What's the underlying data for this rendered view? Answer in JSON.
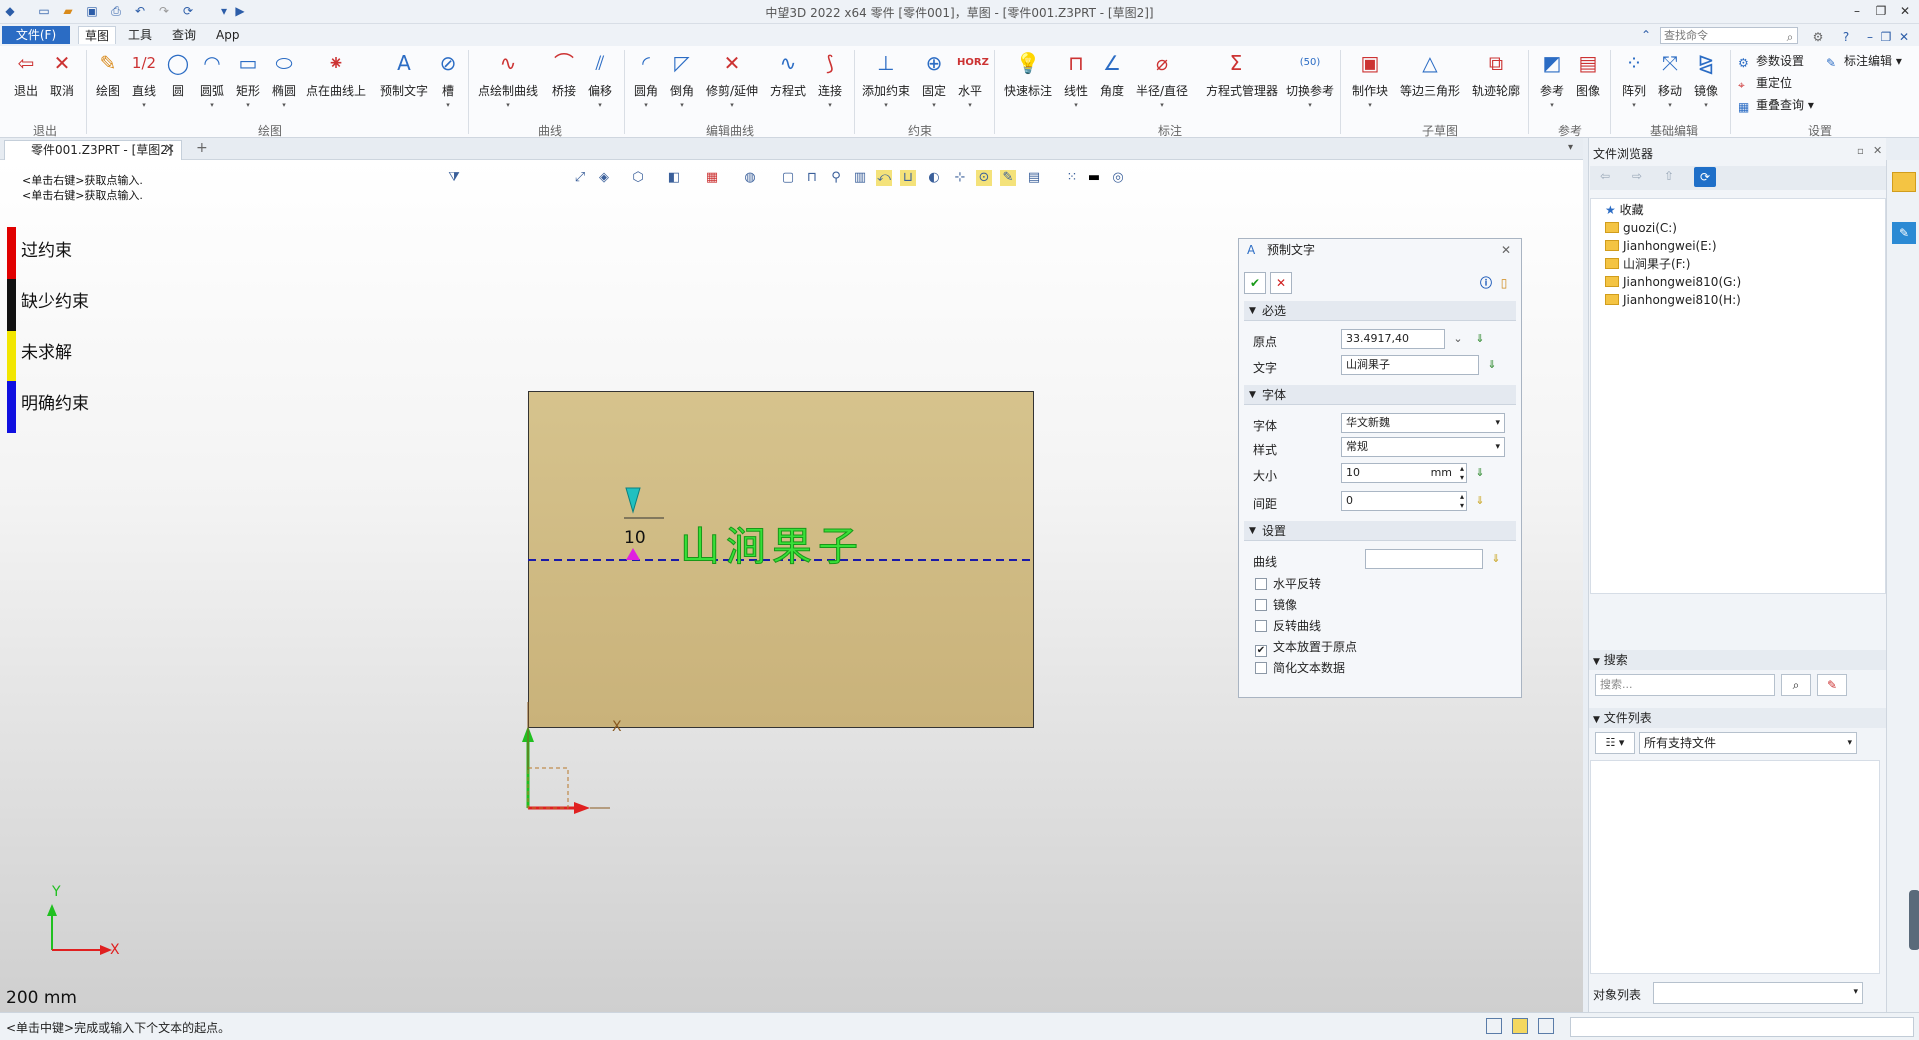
{
  "title_bar": {
    "title": "中望3D 2022 x64        零件 [零件001]，草图 - [零件001.Z3PRT - [草图2]]"
  },
  "menu": {
    "file": "文件(F)",
    "items": [
      "草图",
      "工具",
      "查询",
      "App"
    ],
    "search_placeholder": "查找命令"
  },
  "ribbon": {
    "buttons": {
      "exit": "退出",
      "cancel": "取消",
      "draw": "绘图",
      "line": "直线",
      "circle": "圆",
      "arc": "圆弧",
      "rect": "矩形",
      "ellipse": "椭圆",
      "point_on_curve": "点在曲线上",
      "preset_text": "预制文字",
      "slot": "槽",
      "spline": "点绘制曲线",
      "bridge": "桥接",
      "offset": "偏移",
      "fillet": "圆角",
      "chamfer": "倒角",
      "trim": "修剪/延伸",
      "equation": "方程式",
      "connect": "连接",
      "add_constraint": "添加约束",
      "fix": "固定",
      "horizontal": "水平",
      "quick_dim": "快速标注",
      "linear": "线性",
      "angle": "角度",
      "radius": "半径/直径",
      "eq_manager": "方程式管理器",
      "toggle_ref": "切换参考",
      "make_block": "制作块",
      "equilateral": "等边三角形",
      "trace_outline": "轨迹轮廓",
      "reference": "参考",
      "image": "图像",
      "array": "阵列",
      "move": "移动",
      "mirror": "镜像"
    },
    "icon_texts": {
      "line": "1/2",
      "horizontal": "HORZ",
      "toggle_ref": "(50)"
    },
    "small_cmds": {
      "param_settings": "参数设置",
      "relocate": "重定位",
      "overlap_query": "重叠查询",
      "dim_edit": "标注编辑"
    },
    "groups": {
      "exit": "退出",
      "draw": "绘图",
      "curve": "曲线",
      "edit": "编辑曲线",
      "constraint": "约束",
      "dimension": "标注",
      "sub": "子草图",
      "ref": "参考",
      "basic_edit": "基础编辑",
      "settings": "设置"
    }
  },
  "doc_tab": "零件001.Z3PRT - [草图2]",
  "viewport": {
    "prompts": [
      "<单击右键>获取点输入.",
      "<单击右键>获取点输入."
    ],
    "legend": [
      {
        "label": "过约束",
        "color": "#e00000"
      },
      {
        "label": "缺少约束",
        "color": "#111111"
      },
      {
        "label": "未求解",
        "color": "#f2e600"
      },
      {
        "label": "明确约束",
        "color": "#1010e0"
      }
    ],
    "sketch_text": "山涧果子",
    "dim_value": "10",
    "axis_x": "X",
    "axis_y": "Y",
    "scale": "200 mm"
  },
  "dialog": {
    "title": "预制文字",
    "sections": {
      "required": "必选",
      "font": "字体",
      "settings": "设置"
    },
    "fields": {
      "origin_label": "原点",
      "origin_value": "33.4917,40",
      "text_label": "文字",
      "text_value": "山涧果子",
      "font_label": "字体",
      "font_value": "华文新魏",
      "style_label": "样式",
      "style_value": "常规",
      "size_label": "大小",
      "size_value": "10",
      "size_unit": "mm",
      "spacing_label": "间距",
      "spacing_value": "0",
      "curve_label": "曲线"
    },
    "checkboxes": [
      {
        "label": "水平反转",
        "checked": false
      },
      {
        "label": "镜像",
        "checked": false
      },
      {
        "label": "反转曲线",
        "checked": false
      },
      {
        "label": "文本放置于原点",
        "checked": true
      },
      {
        "label": "简化文本数据",
        "checked": false
      }
    ]
  },
  "file_browser": {
    "title": "文件浏览器",
    "tree": [
      "收藏",
      "guozi(C:)",
      "Jianhongwei(E:)",
      "山涧果子(F:)",
      "Jianhongwei810(G:)",
      "Jianhongwei810(H:)"
    ],
    "search_title": "搜索",
    "search_placeholder": "搜索...",
    "file_list_title": "文件列表",
    "filter": "所有支持文件",
    "object_list_label": "对象列表"
  },
  "status": {
    "message": "<单击中键>完成或输入下个文本的起点。"
  }
}
